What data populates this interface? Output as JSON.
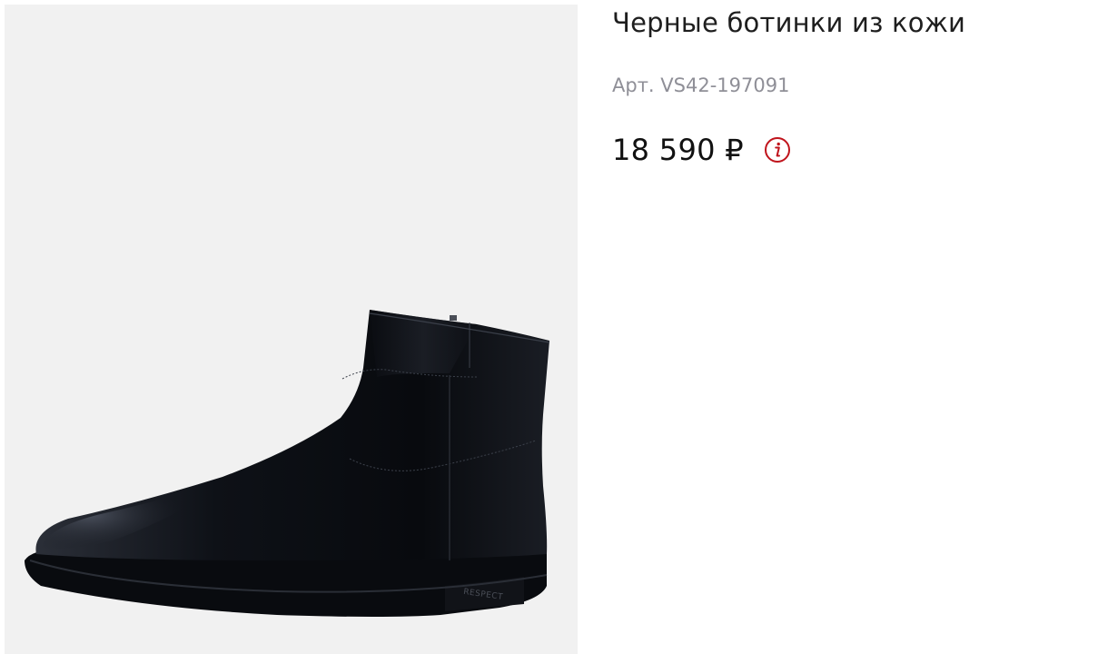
{
  "product": {
    "title": "Черные ботинки из кожи",
    "sku": "Арт. VS42-197091",
    "price": "18 590 ₽",
    "image": {
      "subject": "black-leather-ankle-boot",
      "brand_mark": "RESPECT",
      "background_color": "#f1f1f1"
    }
  },
  "icons": {
    "price_info": "info-circle-icon"
  },
  "colors": {
    "accent": "#c0141c",
    "text_primary": "#1e1e1e",
    "text_muted": "#8f8f97"
  }
}
